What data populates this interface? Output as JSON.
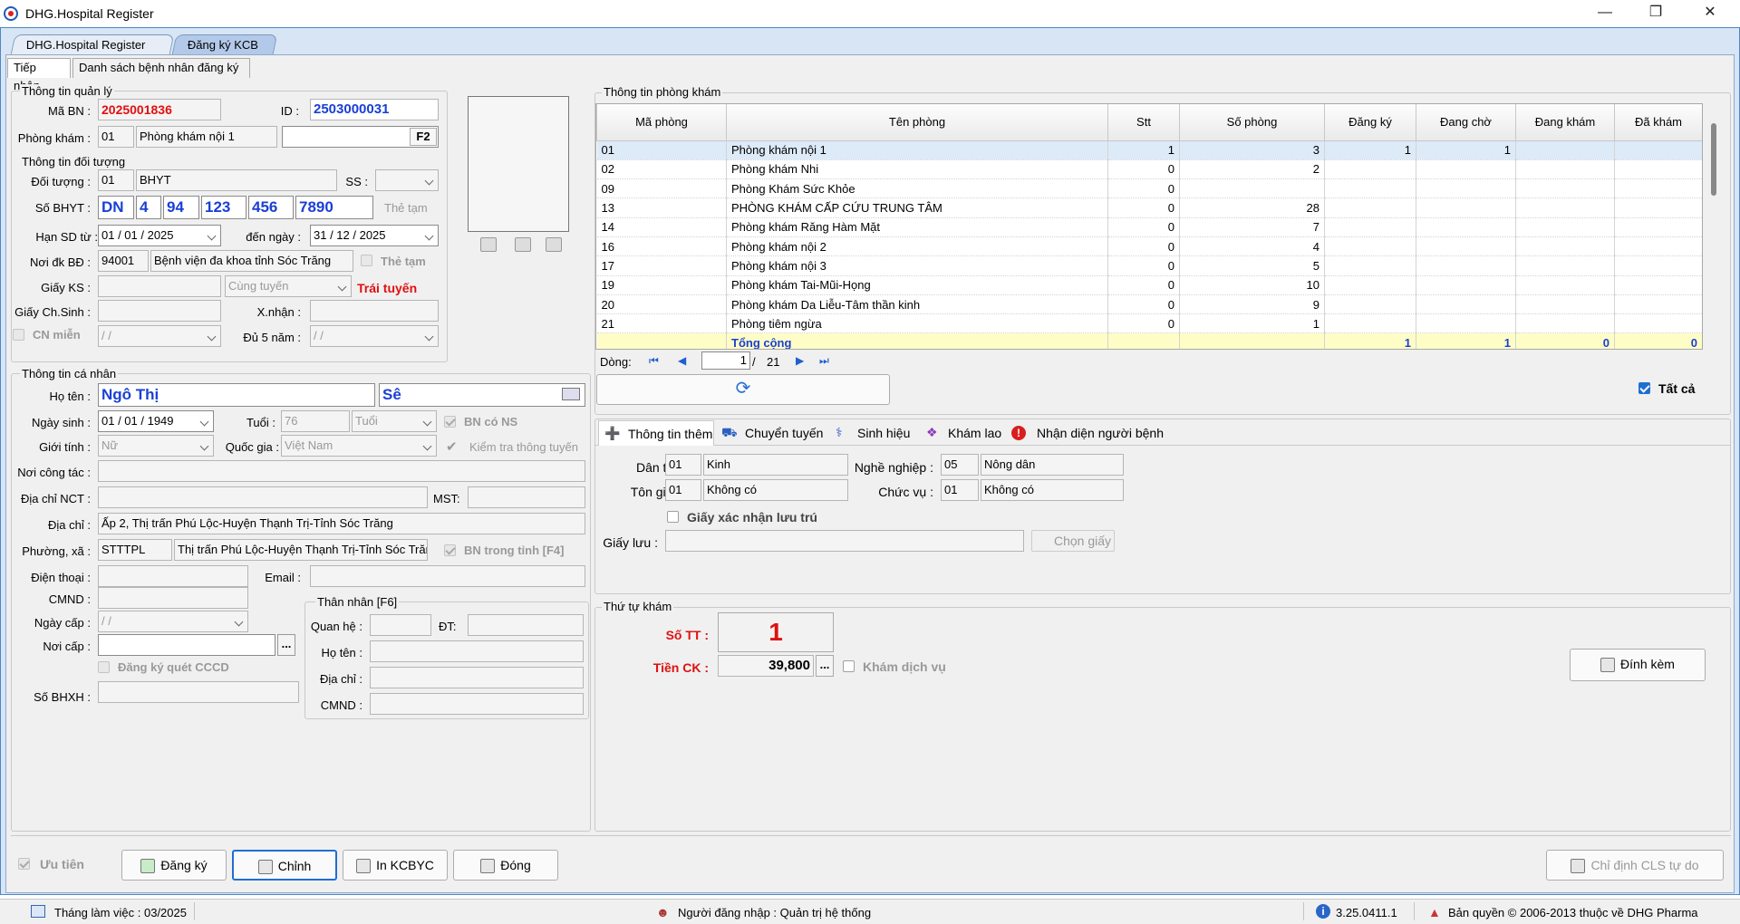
{
  "window": {
    "title": "DHG.Hospital Register"
  },
  "doc_tabs": [
    "DHG.Hospital Register",
    "Đăng ký KCB"
  ],
  "sub_tabs": [
    "Tiếp nhận",
    "Danh sách bệnh nhân đăng ký"
  ],
  "quan_ly": {
    "group": "Thông tin quản lý",
    "ma_bn_label": "Mã BN :",
    "ma_bn": "2025001836",
    "id_label": "ID :",
    "id": "2503000031",
    "phong_kham_label": "Phòng khám :",
    "phong_code": "01",
    "phong_name": "Phòng khám nội 1",
    "f2": "F2"
  },
  "doi_tuong": {
    "group": "Thông tin đối tượng",
    "doi_tuong_label": "Đối tượng :",
    "dt_code": "01",
    "dt_name": "BHYT",
    "ss_label": "SS :",
    "so_bhyt_label": "Số BHYT :",
    "bhyt": [
      "DN",
      "4",
      "94",
      "123",
      "456",
      "7890"
    ],
    "the_tam_btn": "Thẻ tạm",
    "han_sd_label": "Hạn SD từ :",
    "han_tu": "01 / 01 / 2025",
    "den_ngay_label": "đến ngày :",
    "han_den": "31 / 12 / 2025",
    "noi_dk_label": "Nơi đk BĐ :",
    "noi_dk_code": "94001",
    "noi_dk_name": "Bệnh viện đa khoa tỉnh Sóc Trăng",
    "the_tam_chk": "Thẻ tạm",
    "giay_ks_label": "Giấy KS :",
    "cung_tuyen": "Cùng tuyến",
    "trai_tuyen": "Trái tuyến",
    "giay_cs_label": "Giấy Ch.Sinh :",
    "xnhan_label": "X.nhận :",
    "cn_mien": "CN miễn",
    "date_blank": "  /    /",
    "du5_label": "Đủ 5 năm :"
  },
  "ca_nhan": {
    "group": "Thông tin cá nhân",
    "ho_ten_label": "Họ tên :",
    "ho": "Ngô Thị",
    "ten": "Sê",
    "ngay_sinh_label": "Ngày sinh :",
    "ngay_sinh": "01 / 01 / 1949",
    "tuoi_label": "Tuổi :",
    "tuoi": "76",
    "tuoi_unit": "Tuổi",
    "bn_co_ns": "BN có NS",
    "gioi_tinh_label": "Giới tính :",
    "gioi_tinh": "Nữ",
    "quoc_gia_label": "Quốc gia :",
    "quoc_gia": "Việt Nam",
    "kiem_tra": "Kiểm tra thông tuyến",
    "noi_cong_tac_label": "Nơi công tác :",
    "dia_chi_nct_label": "Địa chỉ  NCT :",
    "mst_label": "MST:",
    "dia_chi_label": "Địa chỉ :",
    "dia_chi": "Ấp 2, Thị trấn Phú Lộc-Huyện Thạnh Trị-Tỉnh Sóc Trăng",
    "phuong_xa_label": "Phường, xã :",
    "px_code": "STTTPL",
    "px_name": "Thị trấn Phú Lộc-Huyện Thạnh Trị-Tỉnh Sóc Trăng",
    "bn_trong_tinh": "BN trong tỉnh [F4]",
    "dien_thoai_label": "Điện thoại :",
    "email_label": "Email :",
    "cmnd_label": "CMND :",
    "ngay_cap_label": "Ngày cấp :",
    "noi_cap_label": "Nơi cấp :",
    "dang_ky_cccd": "Đăng ký quét CCCD",
    "so_bhxh_label": "Số BHXH :"
  },
  "than_nhan": {
    "group": "Thân nhân [F6]",
    "quan_he_label": "Quan hệ :",
    "dt_label": "ĐT:",
    "ho_ten_label": "Họ tên :",
    "dia_chi_label": "Địa chỉ :",
    "cmnd_label": "CMND :"
  },
  "phong_kham": {
    "group": "Thông tin phòng khám",
    "headers": [
      "Mã phòng",
      "Tên phòng",
      "Stt",
      "Số phòng",
      "Đăng ký",
      "Đang chờ",
      "Đang khám",
      "Đã khám"
    ],
    "rows": [
      [
        "01",
        "Phòng khám nội 1",
        "1",
        "3",
        "1",
        "1",
        "",
        ""
      ],
      [
        "02",
        "Phòng khám Nhi",
        "0",
        "2",
        "",
        "",
        "",
        ""
      ],
      [
        "09",
        "Phòng Khám Sức Khỏe",
        "0",
        "",
        "",
        "",
        "",
        ""
      ],
      [
        "13",
        "PHÒNG KHÁM CẤP CỨU TRUNG TÂM",
        "0",
        "28",
        "",
        "",
        "",
        ""
      ],
      [
        "14",
        "Phòng khám Răng Hàm Mặt",
        "0",
        "7",
        "",
        "",
        "",
        ""
      ],
      [
        "16",
        "Phòng khám nội 2",
        "0",
        "4",
        "",
        "",
        "",
        ""
      ],
      [
        "17",
        "Phòng khám nội 3",
        "0",
        "5",
        "",
        "",
        "",
        ""
      ],
      [
        "19",
        "Phòng khám Tai-Mũi-Họng",
        "0",
        "10",
        "",
        "",
        "",
        ""
      ],
      [
        "20",
        "Phòng khám Da Liễu-Tâm thần kinh",
        "0",
        "9",
        "",
        "",
        "",
        ""
      ],
      [
        "21",
        "Phòng tiêm ngừa",
        "0",
        "1",
        "",
        "",
        "",
        ""
      ]
    ],
    "total": {
      "label": "Tổng cộng",
      "dang_ky": "1",
      "dang_cho": "1",
      "dang_kham": "0",
      "da_kham": "0"
    },
    "nav_label": "Dòng:",
    "nav_current": "1",
    "nav_total": "21",
    "tat_ca": "Tất cả"
  },
  "info_tabs": [
    "Thông tin thêm",
    "Chuyển tuyến",
    "Sinh hiệu",
    "Khám lao",
    "Nhận diện người bệnh"
  ],
  "thong_tin_them": {
    "dan_toc_label": "Dân tộc :",
    "dan_toc_code": "01",
    "dan_toc": "Kinh",
    "nghe_nghiep_label": "Nghề nghiệp :",
    "nn_code": "05",
    "nghe_nghiep": "Nông dân",
    "ton_giao_label": "Tôn giáo :",
    "tg_code": "01",
    "ton_giao": "Không có",
    "chuc_vu_label": "Chức vụ :",
    "cv_code": "01",
    "chuc_vu": "Không có",
    "giay_xac_nhan": "Giấy xác nhận lưu trú",
    "giay_luu_label": "Giấy lưu :",
    "chon_giay": "Chọn giấy"
  },
  "thu_tu": {
    "group": "Thứ tự khám",
    "so_tt_label": "Số TT :",
    "so_tt": "1",
    "tien_ck_label": "Tiền CK :",
    "tien_ck": "39,800",
    "kham_dich_vu": "Khám dịch vụ",
    "dinh_kem": "Đính kèm"
  },
  "bottom": {
    "uu_tien": "Ưu tiên",
    "dang_ky": "Đăng ký",
    "chinh": "Chỉnh",
    "in_kcbyc": "In KCBYC",
    "dong": "Đóng",
    "chi_dinh": "Chỉ định CLS tự do"
  },
  "status": {
    "thang": "Tháng làm việc : 03/2025",
    "nguoi": "Người đăng nhập : Quản trị hệ thống",
    "version": "3.25.0411.1",
    "ban_quyen": "Bản quyền © 2006-2013 thuộc về DHG Pharma"
  }
}
